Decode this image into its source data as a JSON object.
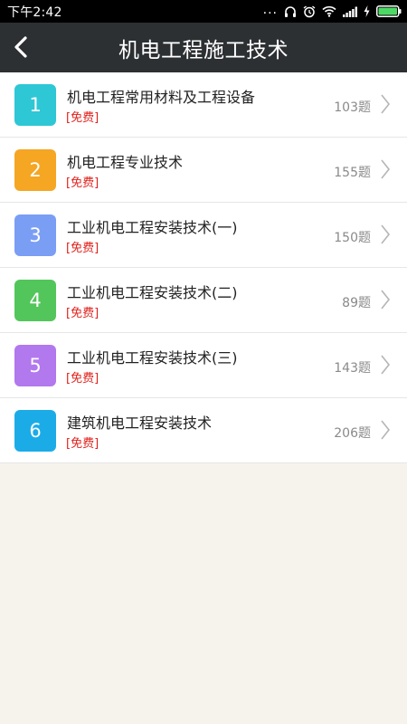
{
  "status_bar": {
    "time": "下午2:42",
    "more": "...",
    "icons": [
      "headset-icon",
      "alarm-icon",
      "wifi-icon",
      "signal-icon",
      "charging-icon",
      "battery-icon"
    ]
  },
  "header": {
    "title": "机电工程施工技术",
    "back_icon": "back-chevron-icon"
  },
  "colors": {
    "header_bg": "#2d3033",
    "page_bg": "#f6f3ed",
    "tag_red": "#e0211c"
  },
  "chapters": [
    {
      "number": "1",
      "title": "机电工程常用材料及工程设备",
      "tag": "[免费]",
      "count": "103题",
      "color": "#2ec7d6"
    },
    {
      "number": "2",
      "title": "机电工程专业技术",
      "tag": "[免费]",
      "count": "155题",
      "color": "#f5a623"
    },
    {
      "number": "3",
      "title": "工业机电工程安装技术(一)",
      "tag": "[免费]",
      "count": "150题",
      "color": "#7b9ef5"
    },
    {
      "number": "4",
      "title": "工业机电工程安装技术(二)",
      "tag": "[免费]",
      "count": "89题",
      "color": "#52c65a"
    },
    {
      "number": "5",
      "title": "工业机电工程安装技术(三)",
      "tag": "[免费]",
      "count": "143题",
      "color": "#b278ee"
    },
    {
      "number": "6",
      "title": "建筑机电工程安装技术",
      "tag": "[免费]",
      "count": "206题",
      "color": "#1bace8"
    }
  ]
}
